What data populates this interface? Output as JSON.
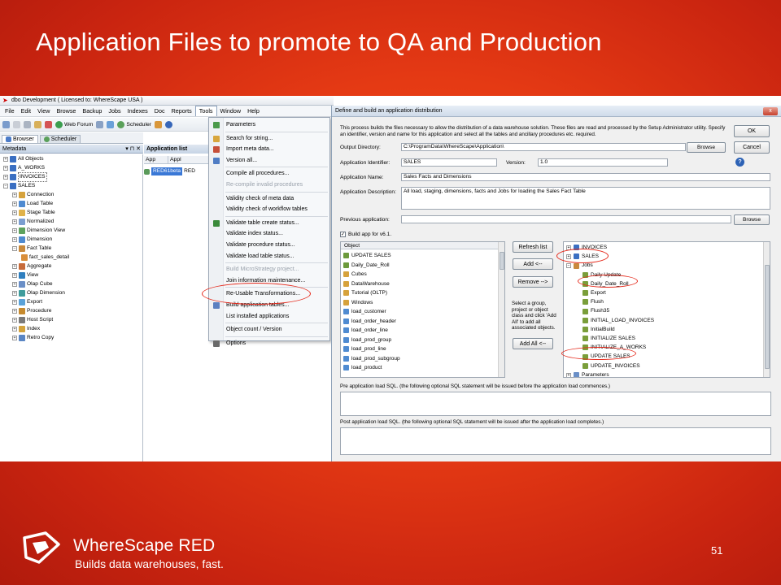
{
  "slide": {
    "title": "Application Files to promote to QA and Production",
    "page_number": "51",
    "brand": "WhereScape RED",
    "tagline": "Builds data warehouses, fast."
  },
  "app": {
    "window_title": "dbo  Development  ( Licensed to: WhereScape USA )",
    "menu": [
      "File",
      "Edit",
      "View",
      "Browse",
      "Backup",
      "Jobs",
      "Indexes",
      "Doc",
      "Reports",
      "Tools",
      "Window",
      "Help"
    ],
    "toolbar": {
      "web_forum": "Web Forum",
      "scheduler": "Scheduler"
    },
    "tabs": {
      "browser": "Browser",
      "scheduler": "Scheduler"
    },
    "metadata_header": "Metadata",
    "tree": [
      {
        "label": "All Objects",
        "level": 0
      },
      {
        "label": "A_WORKS",
        "level": 0
      },
      {
        "label": "INVOICES",
        "level": 0
      },
      {
        "label": "SALES",
        "level": 0
      },
      {
        "label": "Connection",
        "level": 1
      },
      {
        "label": "Load Table",
        "level": 1
      },
      {
        "label": "Stage Table",
        "level": 1
      },
      {
        "label": "Normalized",
        "level": 1
      },
      {
        "label": "Dimension View",
        "level": 1
      },
      {
        "label": "Dimension",
        "level": 1
      },
      {
        "label": "Fact Table",
        "level": 1
      },
      {
        "label": "fact_sales_detail",
        "level": 2
      },
      {
        "label": "Aggregate",
        "level": 1
      },
      {
        "label": "View",
        "level": 1
      },
      {
        "label": "Olap Cube",
        "level": 1
      },
      {
        "label": "Olap Dimension",
        "level": 1
      },
      {
        "label": "Export",
        "level": 1
      },
      {
        "label": "Procedure",
        "level": 1
      },
      {
        "label": "Host Script",
        "level": 1
      },
      {
        "label": "Index",
        "level": 1
      },
      {
        "label": "Retro Copy",
        "level": 1
      }
    ],
    "applist": {
      "header": "Application list",
      "col_app": "App",
      "col_app2": "Appl",
      "row_name": "RED61beta",
      "row_trunc": "RED"
    }
  },
  "tools_menu": [
    {
      "label": "Parameters",
      "disabled": false
    },
    {
      "label": "Search for string...",
      "disabled": false
    },
    {
      "label": "Import meta data...",
      "disabled": false
    },
    {
      "label": "Version all...",
      "disabled": false
    },
    {
      "label": "Compile all procedures...",
      "disabled": false
    },
    {
      "label": "Re-compile invalid procedures",
      "disabled": true
    },
    {
      "label": "Validity check of meta data",
      "disabled": false
    },
    {
      "label": "Validity check of workflow tables",
      "disabled": false
    },
    {
      "label": "Validate table create status...",
      "disabled": false
    },
    {
      "label": "Validate index status...",
      "disabled": false
    },
    {
      "label": "Validate procedure status...",
      "disabled": false
    },
    {
      "label": "Validate load table status...",
      "disabled": false
    },
    {
      "label": "Build MicroStrategy project...",
      "disabled": true
    },
    {
      "label": "Join information maintenance...",
      "disabled": false
    },
    {
      "label": "Re-Usable Transformations...",
      "disabled": false
    },
    {
      "label": "Build application tables...",
      "disabled": false
    },
    {
      "label": "List installed applications",
      "disabled": false
    },
    {
      "label": "Object count / Version",
      "disabled": false
    },
    {
      "label": "Options",
      "disabled": false
    }
  ],
  "dialog": {
    "title": "Define and build an application distribution",
    "close": "x",
    "description": "This process builds the files necessary to allow the distribution of a data warehouse solution. These files are read and processed by the Setup Administrator utility. Specify an identifier, version and name for this application and select all the tables and ancillary procedures etc. required.",
    "ok": "OK",
    "cancel": "Cancel",
    "output_dir_label": "Output Directory:",
    "output_dir_value": "C:\\ProgramData\\WhereScape\\Application\\",
    "browse": "Browse",
    "app_id_label": "Application Identifier:",
    "app_id_value": "SALES",
    "version_label": "Version:",
    "version_value": "1.0",
    "app_name_label": "Application Name:",
    "app_name_value": "Sales Facts and Dimensions",
    "app_desc_label": "Application Description:",
    "app_desc_value": "All load, staging, dimensions, facts and Jobs for loading the Sales Fact Table",
    "prev_app_label": "Previous application:",
    "prev_app_value": "",
    "build_v61_label": "Build app for v6.1.",
    "build_v61_checked": "✓",
    "object_header": "Object",
    "objects": [
      "UPDATE SALES",
      "Daily_Date_Roll",
      "Cubes",
      "DataWarehouse",
      "Tutorial (OLTP)",
      "Windows",
      "load_customer",
      "load_order_header",
      "load_order_line",
      "load_prod_group",
      "load_prod_line",
      "load_prod_subgroup",
      "load_product"
    ],
    "refresh_list": "Refresh list",
    "add": "Add  <--",
    "remove": "Remove -->",
    "hint": "Select a group, project or object class and click 'Add All' to add all associated objects.",
    "add_all": "Add All  <--",
    "selected_tree": [
      {
        "label": "INVOICES",
        "level": 0
      },
      {
        "label": "SALES",
        "level": 0
      },
      {
        "label": "Jobs",
        "level": 0
      },
      {
        "label": "Daily Update",
        "level": 1
      },
      {
        "label": "Daily_Date_Roll",
        "level": 1
      },
      {
        "label": "Export",
        "level": 1
      },
      {
        "label": "Flush",
        "level": 1
      },
      {
        "label": "Flush35",
        "level": 1
      },
      {
        "label": "INITIAL_LOAD_INVOICES",
        "level": 1
      },
      {
        "label": "InitialBuild",
        "level": 1
      },
      {
        "label": "INITIALIZE SALES",
        "level": 1
      },
      {
        "label": "INITIALIZE_A_WORKS",
        "level": 1
      },
      {
        "label": "UPDATE SALES",
        "level": 1
      },
      {
        "label": "UPDATE_INVOICES",
        "level": 1
      },
      {
        "label": "Parameters",
        "level": 0
      }
    ],
    "pre_sql_label": "Pre application load SQL.  (the following optional SQL statement will be issued before the application load commences.)",
    "post_sql_label": "Post application load SQL.  (the following optional SQL statement will be issued after the application load completes.)"
  }
}
